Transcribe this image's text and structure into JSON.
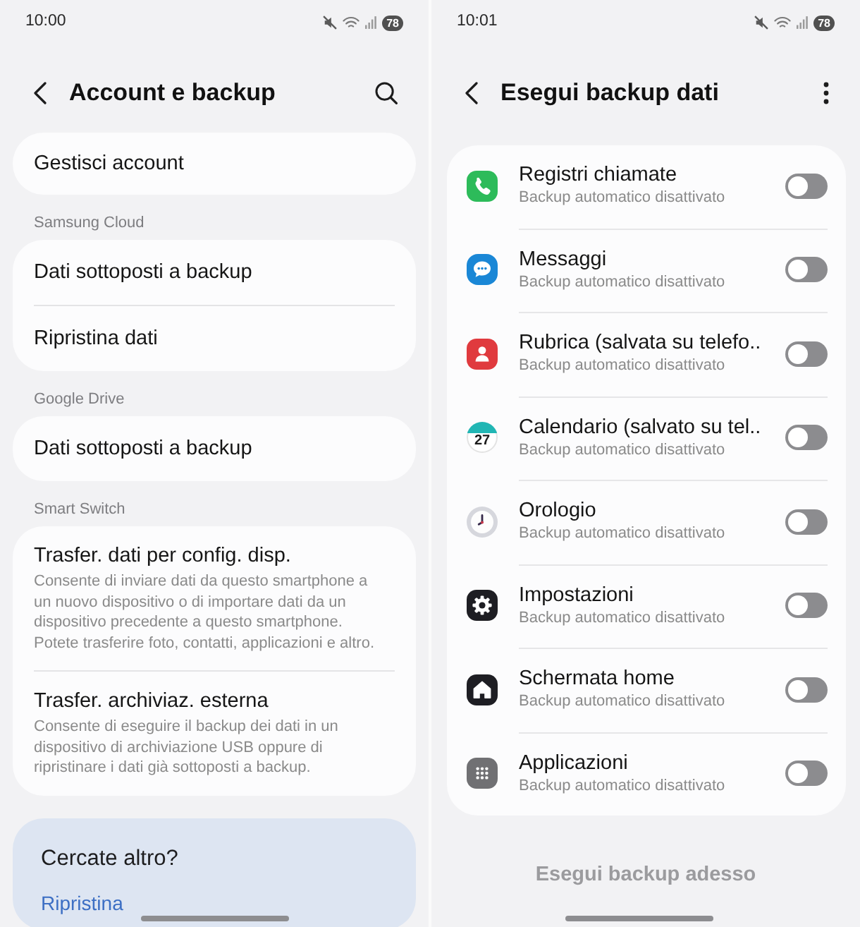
{
  "screens": [
    {
      "kind": "account_backup",
      "status_bar": {
        "time": "10:00",
        "battery": "78"
      },
      "header": {
        "kind": "search",
        "title": "Account e backup"
      },
      "sections": [
        {
          "items": [
            {
              "title": "Gestisci account"
            }
          ]
        },
        {
          "heading": "Samsung Cloud",
          "items": [
            {
              "title": "Dati sottoposti a backup"
            },
            {
              "title": "Ripristina dati"
            }
          ]
        },
        {
          "heading": "Google Drive",
          "items": [
            {
              "title": "Dati sottoposti a backup"
            }
          ]
        },
        {
          "heading": "Smart Switch",
          "items": [
            {
              "title": "Trasfer. dati per config. disp.",
              "description": "Consente di inviare dati da questo smartphone a un nuovo dispositivo o di importare dati da un dispositivo precedente a questo smartphone. Potete trasferire foto, contatti, applicazioni e altro."
            },
            {
              "title": "Trasfer. archiviaz. esterna",
              "description": "Consente di eseguire il backup dei dati in un dispositivo di archiviazione USB oppure di ripristinare i dati già sottoposti a backup."
            }
          ]
        }
      ],
      "suggestion_card": {
        "title": "Cercate altro?",
        "link": "Ripristina"
      }
    },
    {
      "kind": "backup_data",
      "status_bar": {
        "time": "10:01",
        "battery": "78"
      },
      "header": {
        "kind": "more",
        "title": "Esegui backup dati"
      },
      "apps": [
        {
          "kind": "phone",
          "title": "Registri chiamate",
          "subtitle": "Backup automatico disattivato",
          "on": false
        },
        {
          "kind": "messages",
          "title": "Messaggi",
          "subtitle": "Backup automatico disattivato",
          "on": false
        },
        {
          "kind": "contacts",
          "title": "Rubrica (salvata su telefo..",
          "subtitle": "Backup automatico disattivato",
          "on": false
        },
        {
          "kind": "calendar",
          "title": "Calendario (salvato su tel..",
          "subtitle": "Backup automatico disattivato",
          "on": false,
          "icon_label": "27"
        },
        {
          "kind": "clock",
          "title": "Orologio",
          "subtitle": "Backup automatico disattivato",
          "on": false
        },
        {
          "kind": "settings",
          "title": "Impostazioni",
          "subtitle": "Backup automatico disattivato",
          "on": false
        },
        {
          "kind": "home",
          "title": "Schermata home",
          "subtitle": "Backup automatico disattivato",
          "on": false
        },
        {
          "kind": "apps",
          "title": "Applicazioni",
          "subtitle": "Backup automatico disattivato",
          "on": false
        }
      ],
      "backup_button": {
        "label": "Esegui backup adesso",
        "disabled": true
      }
    }
  ]
}
